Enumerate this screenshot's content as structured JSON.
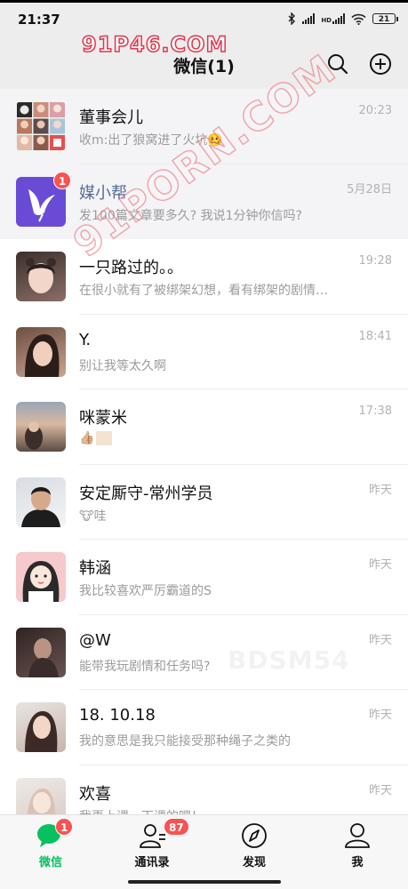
{
  "status_bar": {
    "time": "21:37",
    "network": "HD",
    "battery": "21"
  },
  "header": {
    "title": "微信(1)",
    "search_icon": "search-icon",
    "add_icon": "plus-circle-icon"
  },
  "chats": [
    {
      "name": "董事会儿",
      "time": "20:23",
      "preview": "收m:出了狼窝进了火坑🥴",
      "avatar": "group-avatar",
      "pinned": true
    },
    {
      "name": "媒小帮",
      "time": "5月28日",
      "preview": "发100篇文章要多久? 我说1分钟你信吗?",
      "avatar": "bird-logo-avatar",
      "unread": "1",
      "pinned": true,
      "name_color": "#576b95"
    },
    {
      "name": "一只路过的。。",
      "time": "19:28",
      "preview": "在很小就有了被绑架幻想，看有绑架的剧情…",
      "avatar": "photo-avatar"
    },
    {
      "name": "Y.",
      "time": "18:41",
      "preview": "别让我等太久啊",
      "avatar": "photo-avatar"
    },
    {
      "name": "咪蒙米",
      "time": "17:38",
      "preview": "👍🏼",
      "avatar": "photo-avatar"
    },
    {
      "name": "安定厮守-常州学员",
      "time": "昨天",
      "preview": "🐮哇",
      "avatar": "photo-avatar"
    },
    {
      "name": "韩涵",
      "time": "昨天",
      "preview": "我比较喜欢严厉霸道的S",
      "avatar": "cartoon-avatar"
    },
    {
      "name": "@W",
      "time": "昨天",
      "preview": "能带我玩剧情和任务吗?",
      "avatar": "photo-avatar"
    },
    {
      "name": "18. 10.18",
      "time": "昨天",
      "preview": "我的意思是我只能接受那种绳子之类的",
      "avatar": "photo-avatar"
    },
    {
      "name": "欢喜",
      "time": "昨天",
      "preview": "我再上课，下课的嘿！",
      "avatar": "photo-avatar"
    }
  ],
  "tabs": [
    {
      "label": "微信",
      "icon": "chat-bubble-icon",
      "badge": "1",
      "active": true
    },
    {
      "label": "通讯录",
      "icon": "contacts-icon",
      "badge": "87"
    },
    {
      "label": "发现",
      "icon": "compass-icon"
    },
    {
      "label": "我",
      "icon": "person-icon"
    }
  ],
  "watermarks": {
    "top": "91P46.COM",
    "diagonal": "91PORN.COM",
    "center": "BDSM54"
  },
  "colors": {
    "accent": "#07c160",
    "badge": "#fa5151",
    "header_bg": "#ededed",
    "link_name": "#576b95"
  }
}
